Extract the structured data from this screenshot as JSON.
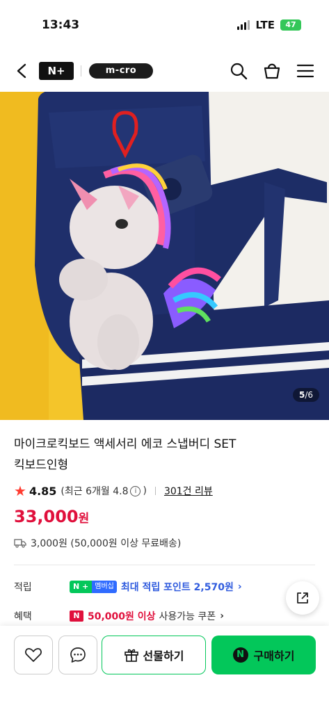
{
  "status": {
    "time": "13:43",
    "network": "LTE",
    "battery": "47"
  },
  "header": {
    "npay_logo": "N+",
    "brand_logo": "m-cro"
  },
  "gallery": {
    "current": "5",
    "total": "/6"
  },
  "product": {
    "title_line1": "마이크로킥보드 액세서리 에코 스냅버디 SET",
    "title_line2": "킥보드인형",
    "rating": "4.85",
    "recent_rating": "(최근 6개월 4.8",
    "recent_close": ")",
    "review_link": "301건 리뷰",
    "price": "33,000",
    "price_unit": "원",
    "shipping": "3,000원 (50,000원 이상 무료배송)"
  },
  "benefits": {
    "points_label": "적립",
    "points_badge_n": "N +",
    "points_badge_member": "멤버십",
    "points_text": "최대 적립 포인트 2,570원",
    "coupon_label": "혜택",
    "coupon_badge": "N",
    "coupon_amount": "50,000원 이상",
    "coupon_text": "사용가능 쿠폰"
  },
  "bottom": {
    "gift_label": "선물하기",
    "buy_label": "구매하기",
    "buy_badge": "N"
  },
  "colors": {
    "accent_green": "#03c75a",
    "price_red": "#e0103c",
    "points_blue": "#2f5bde"
  },
  "icons": [
    "back-icon",
    "search-icon",
    "cart-icon",
    "menu-icon",
    "star-icon",
    "info-icon",
    "truck-icon",
    "share-icon",
    "heart-icon",
    "chat-icon",
    "gift-icon"
  ]
}
